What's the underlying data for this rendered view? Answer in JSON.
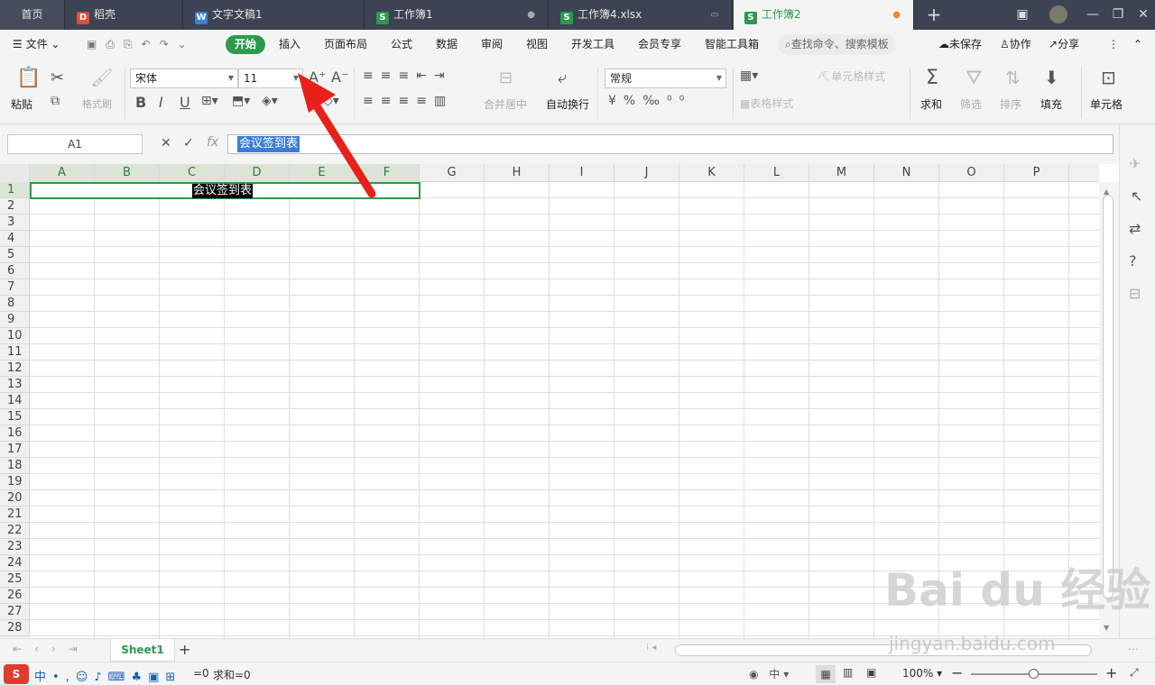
{
  "title_tabs": {
    "home": "首页",
    "tab1": "稻壳",
    "tab2": "文字文稿1",
    "tab3": "工作簿1",
    "tab4": "工作簿4.xlsx",
    "tab5": "工作簿2",
    "new_tab": "+"
  },
  "menu": {
    "file": "文件",
    "start": "开始",
    "insert": "插入",
    "layout": "页面布局",
    "formula": "公式",
    "data": "数据",
    "review": "审阅",
    "view": "视图",
    "dev": "开发工具",
    "member": "会员专享",
    "smart": "智能工具箱",
    "search": "查找命令、搜索模板",
    "unsaved": "未保存",
    "collab": "协作",
    "share": "分享"
  },
  "ribbon": {
    "paste": "粘贴",
    "format_painter": "格式刷",
    "font_name": "宋体",
    "font_size": "11",
    "merge_center": "合并居中",
    "wrap_text": "自动换行",
    "number_format": "常规",
    "cell_style": "单元格样式",
    "table_style": "表格样式",
    "sum": "求和",
    "filter": "筛选",
    "sort": "排序",
    "fill": "填充",
    "cell": "单元格"
  },
  "formula_bar": {
    "name_box": "A1",
    "fx": "fx",
    "content": "会议签到表"
  },
  "grid": {
    "columns": [
      "A",
      "B",
      "C",
      "D",
      "E",
      "F",
      "G",
      "H",
      "I",
      "J",
      "K",
      "L",
      "M",
      "N",
      "O",
      "P"
    ],
    "rows": [
      "1",
      "2",
      "3",
      "4",
      "5",
      "6",
      "7",
      "8",
      "9",
      "10",
      "11",
      "12",
      "13",
      "14",
      "15",
      "16",
      "17",
      "18",
      "19",
      "20",
      "21",
      "22",
      "23",
      "24",
      "25",
      "26",
      "27",
      "28"
    ],
    "cell_a1": "会议签到表"
  },
  "sheet_tabs": {
    "active": "Sheet1",
    "add": "+"
  },
  "status": {
    "count": "=0",
    "sum": "求和=0",
    "zoom": "100%"
  },
  "watermark": {
    "brand": "Bai du 经验",
    "url": "jingyan.baidu.com"
  },
  "colors": {
    "accent": "#2b9a4f",
    "titlebar": "#3c4352",
    "arrow": "#e8201b"
  }
}
